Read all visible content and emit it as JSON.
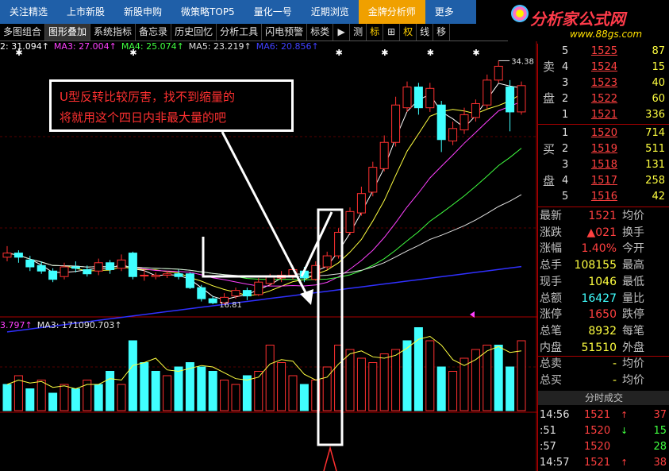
{
  "topnav": {
    "tabs": [
      "关注精选",
      "上市新股",
      "新股申购",
      "微策略TOP5",
      "量化一号",
      "近期浏览",
      "金牌分析师",
      "更多"
    ],
    "active_index": 6
  },
  "logo": {
    "title": "分析家公式网",
    "url": "www.88gs.com"
  },
  "toolbar": {
    "buttons": [
      "多图组合",
      "图形叠加",
      "系统指标",
      "备忘录",
      "历史回忆",
      "分析工具",
      "闪电预警",
      "标类"
    ],
    "icons": [
      {
        "name": "play-icon",
        "glyph": "▶"
      },
      {
        "name": "measure-icon",
        "glyph": "测"
      },
      {
        "name": "mark-icon",
        "glyph": "标"
      },
      {
        "name": "grid-icon",
        "glyph": "⊞"
      },
      {
        "name": "weight-icon",
        "glyph": "权"
      },
      {
        "name": "line-icon",
        "glyph": "线"
      },
      {
        "name": "move-icon",
        "glyph": "移"
      }
    ]
  },
  "indicators": {
    "ma_labels": [
      {
        "text": "2: 31.094↑",
        "color": "#ffffff"
      },
      {
        "text": "MA3: 27.004↑",
        "color": "#ff40ff"
      },
      {
        "text": "MA4: 25.074↑",
        "color": "#40ff40"
      },
      {
        "text": "MA5: 23.219↑",
        "color": "#e0e0e0"
      },
      {
        "text": "MA6: 20.856↑",
        "color": "#4040ff"
      }
    ],
    "vol_labels": [
      {
        "text": "3.797↑",
        "color": "#ff40ff"
      },
      {
        "text": "MA3: 171090.703↑",
        "color": "#e0e0e0"
      }
    ]
  },
  "annotation": {
    "line1": "U型反转比较厉害，找不到缩量的",
    "line2": "将就用这个四日内非最大量的吧"
  },
  "chart_data": {
    "type": "candlestick",
    "price_high_label": "34.38",
    "price_low_label": "16.81",
    "candles": [
      {
        "o": 20.2,
        "c": 20.5,
        "h": 21.0,
        "l": 19.9
      },
      {
        "o": 20.5,
        "c": 20.2,
        "h": 20.7,
        "l": 19.8
      },
      {
        "o": 20.0,
        "c": 19.5,
        "h": 20.3,
        "l": 19.2
      },
      {
        "o": 19.6,
        "c": 19.2,
        "h": 19.9,
        "l": 19.0
      },
      {
        "o": 19.2,
        "c": 18.6,
        "h": 19.4,
        "l": 18.4
      },
      {
        "o": 18.8,
        "c": 19.5,
        "h": 19.8,
        "l": 18.6
      },
      {
        "o": 19.5,
        "c": 19.4,
        "h": 19.9,
        "l": 19.1
      },
      {
        "o": 19.3,
        "c": 19.0,
        "h": 19.6,
        "l": 18.8
      },
      {
        "o": 19.2,
        "c": 19.8,
        "h": 20.1,
        "l": 18.9
      },
      {
        "o": 19.8,
        "c": 19.3,
        "h": 20.0,
        "l": 19.0
      },
      {
        "o": 19.4,
        "c": 20.0,
        "h": 20.4,
        "l": 19.2
      },
      {
        "o": 20.5,
        "c": 18.8,
        "h": 20.6,
        "l": 18.6
      },
      {
        "o": 18.9,
        "c": 18.9,
        "h": 19.3,
        "l": 18.5
      },
      {
        "o": 18.8,
        "c": 18.9,
        "h": 19.1,
        "l": 18.6
      },
      {
        "o": 18.9,
        "c": 19.0,
        "h": 19.2,
        "l": 18.7
      },
      {
        "o": 19.0,
        "c": 18.8,
        "h": 19.3,
        "l": 18.6
      },
      {
        "o": 19.0,
        "c": 18.0,
        "h": 19.1,
        "l": 17.9
      },
      {
        "o": 18.0,
        "c": 17.2,
        "h": 18.2,
        "l": 17.0
      },
      {
        "o": 17.2,
        "c": 16.9,
        "h": 17.4,
        "l": 16.8
      },
      {
        "o": 16.9,
        "c": 17.3,
        "h": 17.6,
        "l": 16.8
      },
      {
        "o": 17.4,
        "c": 17.8,
        "h": 18.0,
        "l": 17.2
      },
      {
        "o": 17.8,
        "c": 17.4,
        "h": 18.0,
        "l": 17.1
      },
      {
        "o": 17.5,
        "c": 18.4,
        "h": 18.7,
        "l": 17.4
      },
      {
        "o": 18.3,
        "c": 18.8,
        "h": 19.0,
        "l": 18.1
      },
      {
        "o": 18.7,
        "c": 18.9,
        "h": 19.2,
        "l": 18.4
      },
      {
        "o": 18.9,
        "c": 19.3,
        "h": 19.6,
        "l": 18.6
      },
      {
        "o": 19.2,
        "c": 18.7,
        "h": 19.5,
        "l": 18.4
      },
      {
        "o": 18.6,
        "c": 19.6,
        "h": 19.9,
        "l": 18.5
      },
      {
        "o": 19.5,
        "c": 20.3,
        "h": 20.6,
        "l": 19.3
      },
      {
        "o": 20.3,
        "c": 22.0,
        "h": 22.3,
        "l": 20.1
      },
      {
        "o": 22.0,
        "c": 23.5,
        "h": 23.8,
        "l": 21.8
      },
      {
        "o": 23.4,
        "c": 24.8,
        "h": 25.3,
        "l": 23.2
      },
      {
        "o": 24.9,
        "c": 26.7,
        "h": 27.1,
        "l": 24.6
      },
      {
        "o": 26.6,
        "c": 28.5,
        "h": 29.0,
        "l": 26.4
      },
      {
        "o": 28.5,
        "c": 31.2,
        "h": 31.8,
        "l": 28.2
      },
      {
        "o": 31.0,
        "c": 32.5,
        "h": 32.9,
        "l": 30.7
      },
      {
        "o": 32.5,
        "c": 31.0,
        "h": 32.8,
        "l": 30.5
      },
      {
        "o": 31.0,
        "c": 32.4,
        "h": 32.8,
        "l": 30.7
      },
      {
        "o": 31.2,
        "c": 28.7,
        "h": 31.5,
        "l": 27.8
      },
      {
        "o": 28.6,
        "c": 29.5,
        "h": 30.0,
        "l": 28.3
      },
      {
        "o": 29.4,
        "c": 30.5,
        "h": 31.0,
        "l": 29.1
      },
      {
        "o": 30.3,
        "c": 31.3,
        "h": 31.6,
        "l": 30.0
      },
      {
        "o": 31.2,
        "c": 33.0,
        "h": 33.4,
        "l": 30.9
      },
      {
        "o": 33.0,
        "c": 34.0,
        "h": 34.4,
        "l": 32.8
      },
      {
        "o": 32.5,
        "c": 30.7,
        "h": 33.0,
        "l": 29.3
      },
      {
        "o": 30.7,
        "c": 32.6,
        "h": 32.9,
        "l": 30.5
      }
    ],
    "volume": [
      {
        "v": 6,
        "up": false
      },
      {
        "v": 8,
        "up": true
      },
      {
        "v": 5,
        "up": false
      },
      {
        "v": 7,
        "up": true
      },
      {
        "v": 4,
        "up": false
      },
      {
        "v": 6,
        "up": true
      },
      {
        "v": 5,
        "up": false
      },
      {
        "v": 7,
        "up": true
      },
      {
        "v": 6,
        "up": false
      },
      {
        "v": 9,
        "up": false
      },
      {
        "v": 6,
        "up": true
      },
      {
        "v": 16,
        "up": false
      },
      {
        "v": 11,
        "up": false
      },
      {
        "v": 9,
        "up": false
      },
      {
        "v": 8,
        "up": true
      },
      {
        "v": 10,
        "up": false
      },
      {
        "v": 11,
        "up": false
      },
      {
        "v": 10,
        "up": false
      },
      {
        "v": 9,
        "up": false
      },
      {
        "v": 7,
        "up": true
      },
      {
        "v": 6,
        "up": true
      },
      {
        "v": 8,
        "up": false
      },
      {
        "v": 9,
        "up": true
      },
      {
        "v": 15,
        "up": true
      },
      {
        "v": 11,
        "up": true
      },
      {
        "v": 8,
        "up": true
      },
      {
        "v": 6,
        "up": false
      },
      {
        "v": 7,
        "up": true
      },
      {
        "v": 10,
        "up": true
      },
      {
        "v": 15,
        "up": true
      },
      {
        "v": 14,
        "up": true
      },
      {
        "v": 12,
        "up": true
      },
      {
        "v": 11,
        "up": true
      },
      {
        "v": 13,
        "up": true
      },
      {
        "v": 14,
        "up": true
      },
      {
        "v": 16,
        "up": false
      },
      {
        "v": 19,
        "up": false
      },
      {
        "v": 16,
        "up": true
      },
      {
        "v": 10,
        "up": false
      },
      {
        "v": 9,
        "up": true
      },
      {
        "v": 12,
        "up": true
      },
      {
        "v": 14,
        "up": true
      },
      {
        "v": 15,
        "up": true
      },
      {
        "v": 15,
        "up": false
      },
      {
        "v": 10,
        "up": false
      },
      {
        "v": 16,
        "up": true
      }
    ]
  },
  "orderbook": {
    "sell_label": [
      "卖",
      "盘"
    ],
    "buy_label": [
      "买",
      "盘"
    ],
    "sells": [
      {
        "level": "5",
        "price": "1525",
        "qty": "87"
      },
      {
        "level": "4",
        "price": "1524",
        "qty": "15"
      },
      {
        "level": "3",
        "price": "1523",
        "qty": "40"
      },
      {
        "level": "2",
        "price": "1522",
        "qty": "60"
      },
      {
        "level": "1",
        "price": "1521",
        "qty": "336"
      }
    ],
    "buys": [
      {
        "level": "1",
        "price": "1520",
        "qty": "714"
      },
      {
        "level": "2",
        "price": "1519",
        "qty": "511"
      },
      {
        "level": "3",
        "price": "1518",
        "qty": "131"
      },
      {
        "level": "4",
        "price": "1517",
        "qty": "258"
      },
      {
        "level": "5",
        "price": "1516",
        "qty": "42"
      }
    ]
  },
  "quote": [
    {
      "k1": "最新",
      "v1": "1521",
      "c1": "red",
      "k2": "均价",
      "v2": ""
    },
    {
      "k1": "涨跌",
      "v1": "▲021",
      "c1": "red",
      "k2": "换手",
      "v2": ""
    },
    {
      "k1": "涨幅",
      "v1": "1.40%",
      "c1": "red",
      "k2": "今开",
      "v2": ""
    },
    {
      "k1": "总手",
      "v1": "108155",
      "c1": "yel",
      "k2": "最高",
      "v2": ""
    },
    {
      "k1": "现手",
      "v1": "1046",
      "c1": "yel",
      "k2": "最低",
      "v2": ""
    },
    {
      "k1": "总额",
      "v1": "16427",
      "c1": "cyn",
      "k2": "量比",
      "v2": ""
    },
    {
      "k1": "涨停",
      "v1": "1650",
      "c1": "red",
      "k2": "跌停",
      "v2": ""
    },
    {
      "k1": "总笔",
      "v1": "8932",
      "c1": "yel",
      "k2": "每笔",
      "v2": ""
    },
    {
      "k1": "内盘",
      "v1": "51510",
      "c1": "yel",
      "k2": "外盘",
      "v2": ""
    },
    {
      "k1": "总卖",
      "v1": "-",
      "c1": "yel",
      "k2": "均价",
      "v2": ""
    },
    {
      "k1": "总买",
      "v1": "-",
      "c1": "yel",
      "k2": "均价",
      "v2": ""
    }
  ],
  "trades_header": "分时成交",
  "trades": [
    {
      "time": "14:56",
      "price": "1521",
      "dir": "↑",
      "dir_color": "#ff4040",
      "vol": "37",
      "vol_color": "#ff4040"
    },
    {
      "time": ":51",
      "price": "1520",
      "dir": "↓",
      "dir_color": "#40ff40",
      "vol": "15",
      "vol_color": "#40ff40"
    },
    {
      "time": ":57",
      "price": "1520",
      "dir": "",
      "dir_color": "#40ff40",
      "vol": "28",
      "vol_color": "#40ff40"
    },
    {
      "time": "14:57",
      "price": "1521",
      "dir": "↑",
      "dir_color": "#ff4040",
      "vol": "38",
      "vol_color": "#ff4040"
    }
  ]
}
